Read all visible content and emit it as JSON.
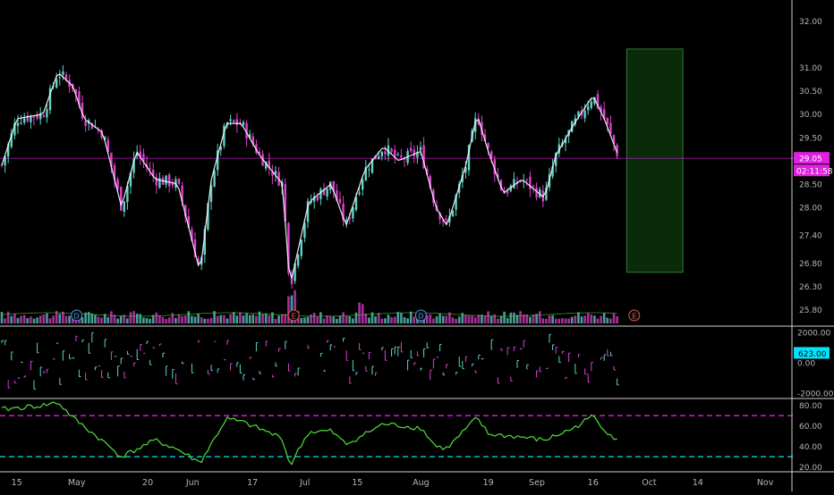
{
  "chart_data": [
    {
      "type": "candlestick",
      "panel": "price",
      "title": "",
      "xlabel": "",
      "ylabel": "",
      "y_ticks": [
        "32.00",
        "31.00",
        "30.50",
        "30.00",
        "29.50",
        "28.50",
        "28.00",
        "27.40",
        "26.80",
        "26.30",
        "25.80"
      ],
      "ylim": [
        25.5,
        32.3
      ],
      "current_price": 29.05,
      "price_label": "29.05",
      "countdown_label": "02:11:58",
      "closes_approx": [
        {
          "x": "Apr 11",
          "y": 28.9
        },
        {
          "x": "Apr 15",
          "y": 29.9
        },
        {
          "x": "Apr 22",
          "y": 30.0
        },
        {
          "x": "Apr 26",
          "y": 30.9
        },
        {
          "x": "Apr 30",
          "y": 30.6
        },
        {
          "x": "May 3",
          "y": 29.9
        },
        {
          "x": "May 8",
          "y": 29.6
        },
        {
          "x": "May 13",
          "y": 28.0
        },
        {
          "x": "May 17",
          "y": 29.2
        },
        {
          "x": "May 22",
          "y": 28.6
        },
        {
          "x": "May 28",
          "y": 28.5
        },
        {
          "x": "Jun 3",
          "y": 26.6
        },
        {
          "x": "Jun 6",
          "y": 28.6
        },
        {
          "x": "Jun 10",
          "y": 29.8
        },
        {
          "x": "Jun 14",
          "y": 29.8
        },
        {
          "x": "Jun 19",
          "y": 29.1
        },
        {
          "x": "Jun 25",
          "y": 28.5
        },
        {
          "x": "Jun 27",
          "y": 26.3
        },
        {
          "x": "Jul 2",
          "y": 28.1
        },
        {
          "x": "Jul 8",
          "y": 28.5
        },
        {
          "x": "Jul 12",
          "y": 27.6
        },
        {
          "x": "Jul 17",
          "y": 28.8
        },
        {
          "x": "Jul 22",
          "y": 29.3
        },
        {
          "x": "Jul 26",
          "y": 29.0
        },
        {
          "x": "Aug 1",
          "y": 29.2
        },
        {
          "x": "Aug 5",
          "y": 28.0
        },
        {
          "x": "Aug 8",
          "y": 27.6
        },
        {
          "x": "Aug 13",
          "y": 28.9
        },
        {
          "x": "Aug 16",
          "y": 30.0
        },
        {
          "x": "Aug 19",
          "y": 29.2
        },
        {
          "x": "Aug 23",
          "y": 28.3
        },
        {
          "x": "Aug 28",
          "y": 28.6
        },
        {
          "x": "Sep 3",
          "y": 28.2
        },
        {
          "x": "Sep 6",
          "y": 29.1
        },
        {
          "x": "Sep 11",
          "y": 29.8
        },
        {
          "x": "Sep 16",
          "y": 30.4
        },
        {
          "x": "Sep 19",
          "y": 29.9
        },
        {
          "x": "Sep 23",
          "y": 29.05
        }
      ],
      "volume_markers": [
        {
          "date": "May 1",
          "label": "D"
        },
        {
          "date": "Jun 28",
          "label": "E"
        },
        {
          "date": "Aug 1",
          "label": "D"
        },
        {
          "date": "Sep 27",
          "label": "E"
        }
      ],
      "projection_box": {
        "x_start": "Sep 25",
        "x_end": "Oct 10",
        "y_low": 26.6,
        "y_high": 31.4,
        "color": "#0a2a0a",
        "border": "#2e7d32"
      }
    },
    {
      "type": "bar",
      "panel": "oscillator",
      "y_ticks": [
        "2000.00",
        "0.00",
        "-2000.00"
      ],
      "ylim": [
        -2300,
        2300
      ],
      "value_label": "623.00",
      "value": 623
    },
    {
      "type": "line",
      "panel": "rsi",
      "y_ticks": [
        "80.00",
        "60.00",
        "40.00",
        "20.00"
      ],
      "ylim": [
        17,
        85
      ],
      "upper_band": 70,
      "lower_band": 30,
      "values_approx": [
        {
          "x": "Apr 11",
          "y": 76
        },
        {
          "x": "Apr 22",
          "y": 80
        },
        {
          "x": "Apr 26",
          "y": 83
        },
        {
          "x": "Apr 30",
          "y": 68
        },
        {
          "x": "May 8",
          "y": 45
        },
        {
          "x": "May 13",
          "y": 30
        },
        {
          "x": "May 22",
          "y": 46
        },
        {
          "x": "May 28",
          "y": 37
        },
        {
          "x": "Jun 3",
          "y": 24
        },
        {
          "x": "Jun 10",
          "y": 67
        },
        {
          "x": "Jun 14",
          "y": 64
        },
        {
          "x": "Jun 19",
          "y": 57
        },
        {
          "x": "Jun 25",
          "y": 48
        },
        {
          "x": "Jun 27",
          "y": 21
        },
        {
          "x": "Jul 2",
          "y": 54
        },
        {
          "x": "Jul 8",
          "y": 55
        },
        {
          "x": "Jul 12",
          "y": 42
        },
        {
          "x": "Jul 22",
          "y": 62
        },
        {
          "x": "Aug 1",
          "y": 58
        },
        {
          "x": "Aug 5",
          "y": 40
        },
        {
          "x": "Aug 8",
          "y": 38
        },
        {
          "x": "Aug 16",
          "y": 68
        },
        {
          "x": "Aug 19",
          "y": 52
        },
        {
          "x": "Aug 28",
          "y": 49
        },
        {
          "x": "Sep 3",
          "y": 46
        },
        {
          "x": "Sep 11",
          "y": 58
        },
        {
          "x": "Sep 16",
          "y": 70
        },
        {
          "x": "Sep 19",
          "y": 57
        },
        {
          "x": "Sep 23",
          "y": 44
        }
      ]
    }
  ],
  "x_axis_labels": [
    "15",
    "May",
    "20",
    "Jun",
    "17",
    "Jul",
    "15",
    "Aug",
    "19",
    "Sep",
    "16",
    "Oct",
    "14",
    "Nov"
  ],
  "colors": {
    "background": "#000000",
    "up": "#5fd3c8",
    "down": "#e040d0",
    "price_line_color": "#e020e0",
    "price_label_bg": "#e020e0",
    "oscillator_label_bg": "#00e5ff",
    "rsi_line": "#4cd137",
    "rsi_band_upper": "#e020e0",
    "rsi_band_lower": "#00e5ff",
    "axis_text": "#b2b5be",
    "panel_border": "#2a2e39"
  }
}
